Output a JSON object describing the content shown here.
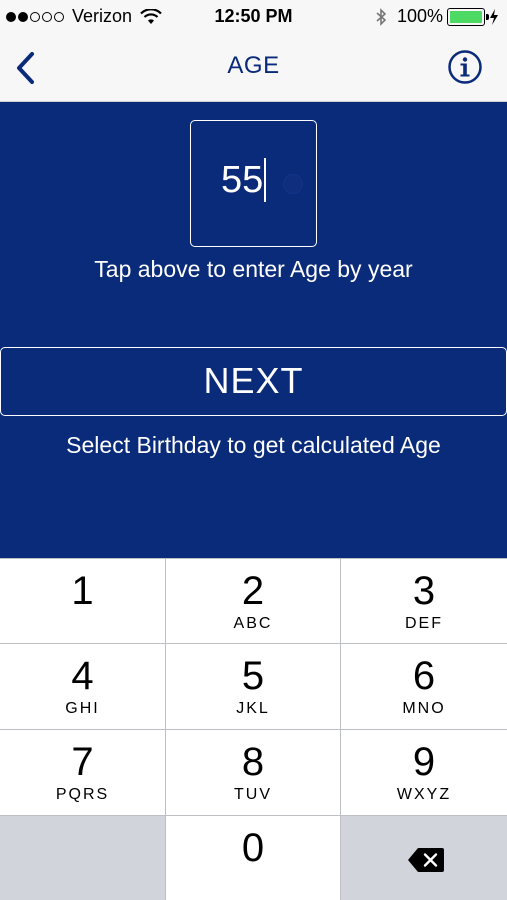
{
  "status_bar": {
    "carrier": "Verizon",
    "time": "12:50 PM",
    "battery_percent": "100%",
    "signal_bars_filled": 2,
    "signal_bars_total": 5,
    "battery_color": "#4cd964"
  },
  "nav": {
    "title": "AGE",
    "back_icon": "chevron-left-icon",
    "info_icon": "info-icon"
  },
  "colors": {
    "brand_blue": "#0a2a7a",
    "nav_background": "#f7f7f7"
  },
  "age_input": {
    "value": "55"
  },
  "hints": {
    "tap_above": "Tap above to enter Age by year",
    "select_birthday": "Select Birthday to get calculated Age"
  },
  "next_button": {
    "label": "NEXT"
  },
  "keypad": {
    "keys": [
      {
        "num": "1",
        "letters": ""
      },
      {
        "num": "2",
        "letters": "ABC"
      },
      {
        "num": "3",
        "letters": "DEF"
      },
      {
        "num": "4",
        "letters": "GHI"
      },
      {
        "num": "5",
        "letters": "JKL"
      },
      {
        "num": "6",
        "letters": "MNO"
      },
      {
        "num": "7",
        "letters": "PQRS"
      },
      {
        "num": "8",
        "letters": "TUV"
      },
      {
        "num": "9",
        "letters": "WXYZ"
      },
      {
        "num": "0",
        "letters": ""
      }
    ],
    "delete_icon": "backspace-icon"
  }
}
